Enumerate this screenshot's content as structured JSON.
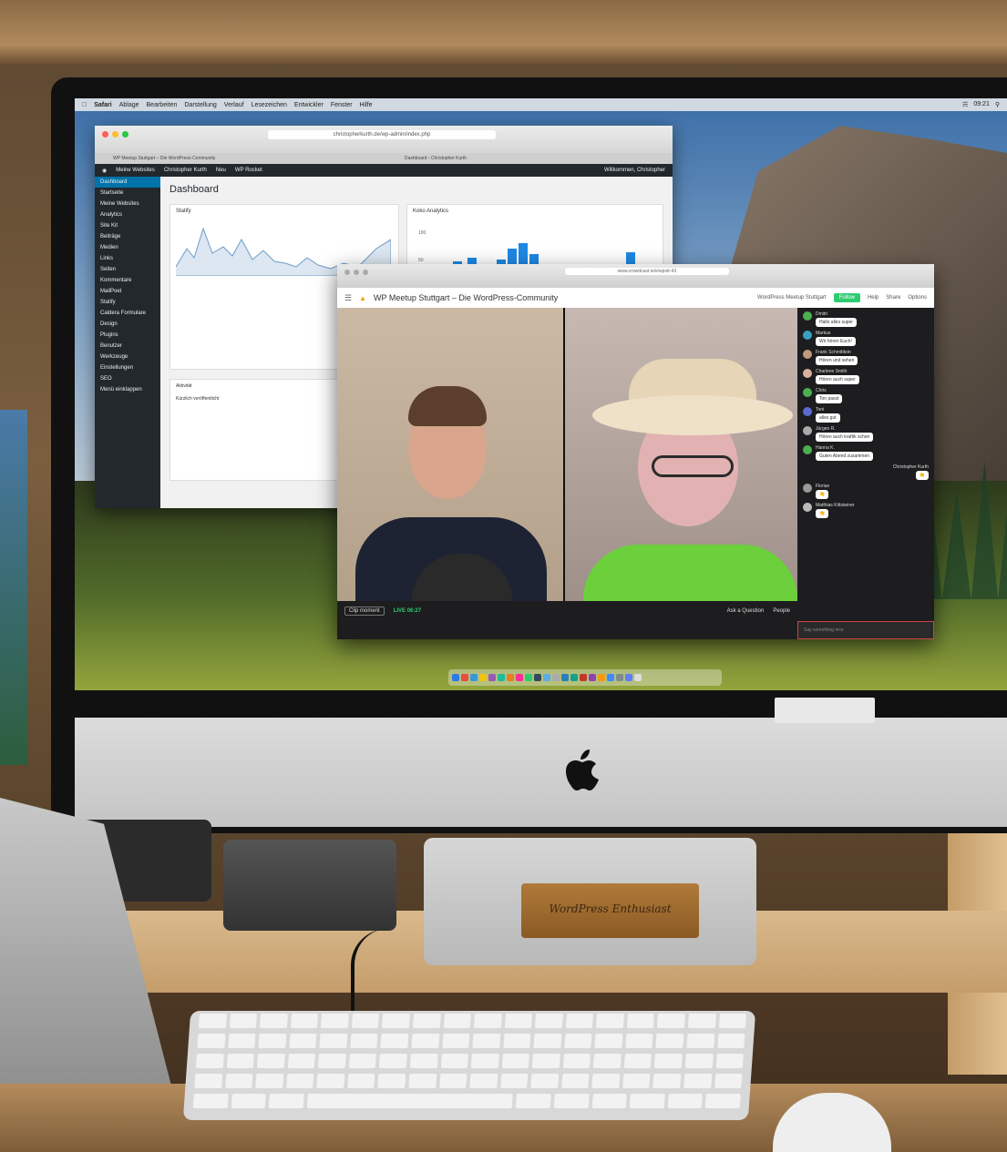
{
  "menubar": {
    "items": [
      "Safari",
      "Ablage",
      "Bearbeiten",
      "Darstellung",
      "Verlauf",
      "Lesezeichen",
      "Entwickler",
      "Fenster",
      "Hilfe"
    ],
    "clock": "09:21"
  },
  "safari": {
    "url": "christopherkurth.de/wp-admin/index.php",
    "tabs": [
      "WP Meetup Stuttgart – Die WordPress-Community",
      "Dashboard ‹ Christopher Kurth"
    ]
  },
  "wp": {
    "adminbar": {
      "items": [
        "Meine Websites",
        "Christopher Kurth",
        "Neu",
        "WP Rocket"
      ],
      "greeting": "Willkommen, Christopher"
    },
    "sidebar": [
      "Dashboard",
      "Startseite",
      "Meine Websites",
      "Analytics",
      "Site Kit",
      "Beiträge",
      "Medien",
      "Links",
      "Seiten",
      "Kommentare",
      "MailPoet",
      "Statify",
      "Caldera Formulare",
      "Design",
      "Plugins",
      "Benutzer",
      "Werkzeuge",
      "Einstellungen",
      "SEO",
      "Menü einklappen"
    ],
    "title": "Dashboard",
    "widgets": {
      "statify": "Statify",
      "koko": "Koko Analytics",
      "activity": "Aktivität",
      "activity_sub": "Kürzlich veröffentlicht",
      "koko_ticks": [
        "100",
        "50"
      ]
    }
  },
  "crowdcast": {
    "url": "www.crowdcast.io/e/wpstr-43",
    "title": "WP Meetup Stuttgart – Die WordPress-Community",
    "org": "WordPress Meetup Stuttgart",
    "follow": "Follow",
    "help": "Help",
    "share": "Share",
    "options": "Options",
    "clip": "Clip moment",
    "live": "LIVE 06:27",
    "ask": "Ask a Question",
    "people": "People",
    "chat_placeholder": "Say something nice",
    "chat": [
      {
        "name": "Dmitri",
        "text": "Hallo alles super"
      },
      {
        "name": "Markus",
        "text": "Wir hören Euch!"
      },
      {
        "name": "Frank Schmittlein",
        "text": "Hören und sehen"
      },
      {
        "name": "Charlene Smith",
        "text": "Hören auch super"
      },
      {
        "name": "Chris",
        "text": "Ton passt"
      },
      {
        "name": "Toni",
        "text": "alles gut"
      },
      {
        "name": "Jürgen R.",
        "text": "Hören auch kraftik schon"
      },
      {
        "name": "Hanna K.",
        "text": "Guten Abend zusammen"
      },
      {
        "name": "Christopher Kurth",
        "text": "👏"
      },
      {
        "name": "Florian",
        "text": "👏"
      },
      {
        "name": "Matthias Kittsteiner",
        "text": "👏"
      }
    ]
  },
  "desk": {
    "plaque": "WordPress Enthusiast"
  },
  "colors": {
    "wp_dark": "#23282d",
    "wp_blue": "#0073aa",
    "crowd_green": "#2ecc71"
  }
}
